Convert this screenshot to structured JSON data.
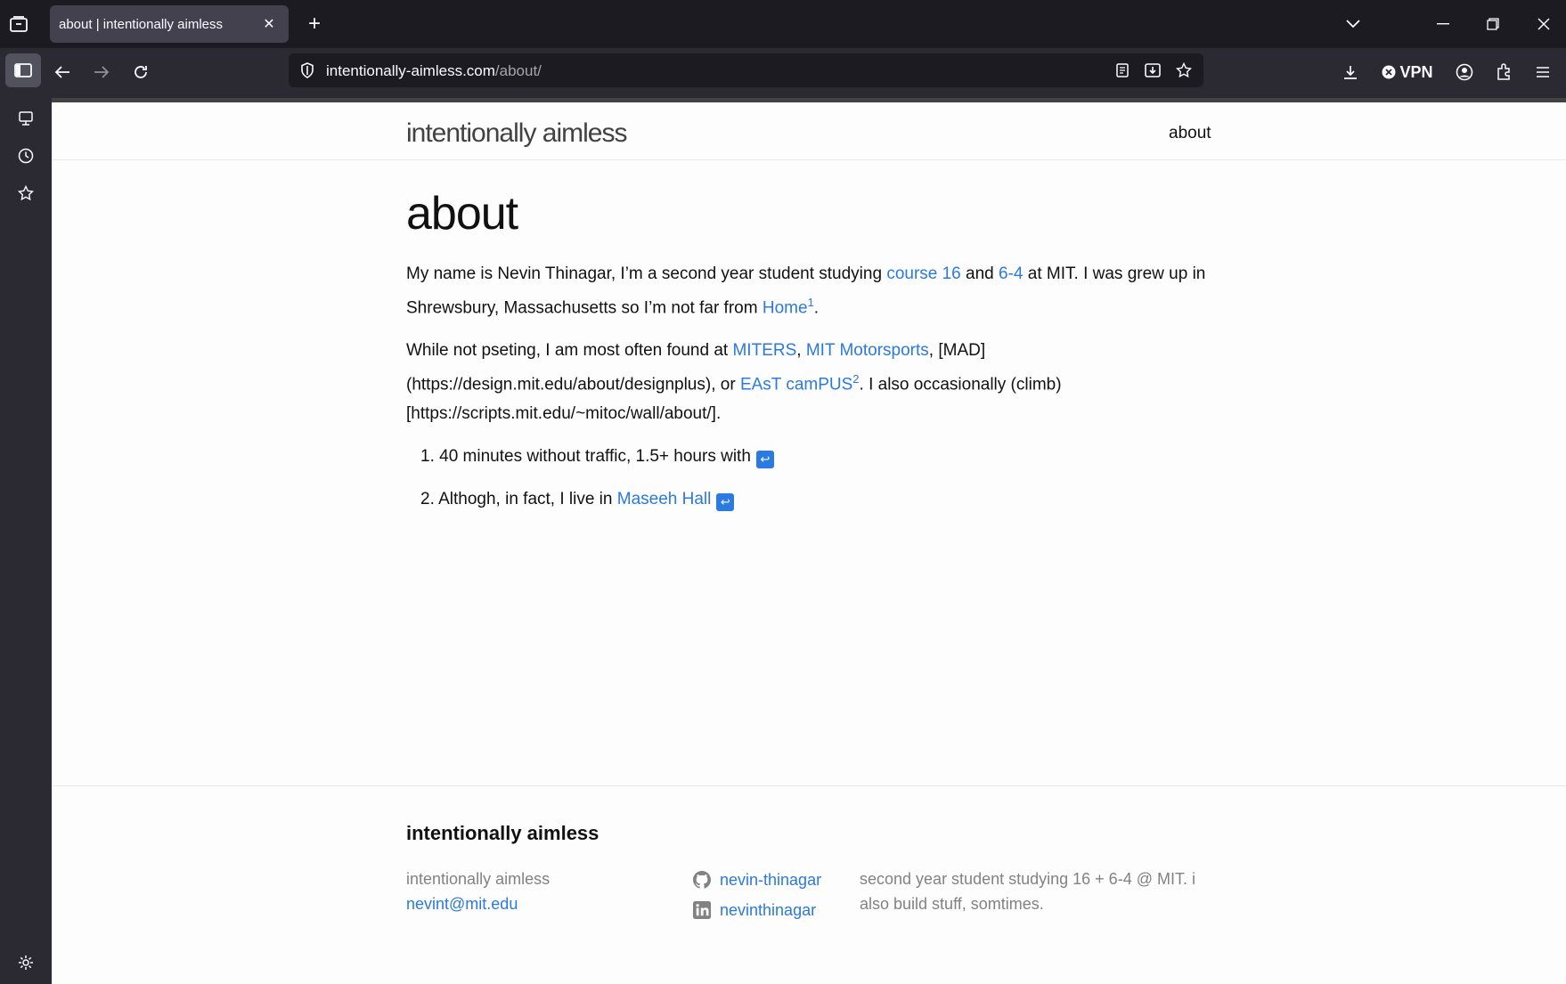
{
  "browser": {
    "tab_title": "about | intentionally aimless",
    "url_host": "intentionally-aimless.com",
    "url_path": "/about/",
    "vpn_label": "VPN"
  },
  "site": {
    "title": "intentionally aimless",
    "nav_about": "about"
  },
  "post": {
    "title": "about",
    "p1": {
      "t1": "My name is Nevin Thinagar, I’m a second year student studying ",
      "link_course16": "course 16",
      "t2": " and ",
      "link_64": "6-4",
      "t3": " at MIT. I was grew up in Shrewsbury, Massachusetts so I’m not far from ",
      "link_home": "Home",
      "fn1": "1",
      "t4": "."
    },
    "p2": {
      "t1": "While not pseting, I am most often found at ",
      "link_miters": "MITERS",
      "t2": ", ",
      "link_motorsports": "MIT Motorsports",
      "t3": ", [MAD](https://design.mit.edu/about/designplus), or ",
      "link_east": "EAsT camPUS",
      "fn2": "2",
      "t4": ". I also occasionally (climb)[https://scripts.mit.edu/~mitoc/wall/about/]."
    },
    "footnotes": [
      {
        "num": "1.",
        "text": "40 minutes without traffic, 1.5+ hours with",
        "link": ""
      },
      {
        "num": "2.",
        "text": "Althogh, in fact, I live in ",
        "link": "Maseeh Hall"
      }
    ],
    "backref": "↩"
  },
  "footer": {
    "heading": "intentionally aimless",
    "name": "intentionally aimless",
    "email": "nevint@mit.edu",
    "github": "nevin-thinagar",
    "linkedin": "nevinthinagar",
    "description": "second year student studying 16 + 6-4 @ MIT. i also build stuff, somtimes."
  },
  "colors": {
    "link": "#2a7ae2",
    "chrome_dark": "#1c1b22",
    "chrome_mid": "#2b2a33"
  }
}
